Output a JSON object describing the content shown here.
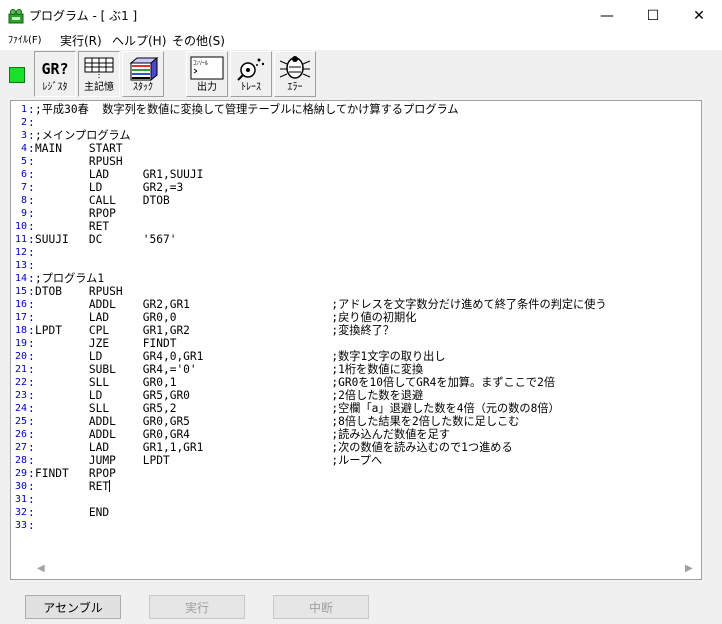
{
  "window": {
    "title": "プログラム - [ ぶ1 ]",
    "minimize": "—",
    "maximize": "☐",
    "close": "✕"
  },
  "menu": [
    {
      "label": "ﾌｧｲﾙ(F)"
    },
    {
      "label": "実行(R)"
    },
    {
      "label": "ヘルプ(H)"
    },
    {
      "label": "その他(S)"
    }
  ],
  "toolbar": {
    "status_color": "#19e028",
    "buttons": [
      {
        "label": "ﾚｼﾞｽﾀ",
        "icon_text": "GR?",
        "icon": "register-icon"
      },
      {
        "label": "主記憶",
        "icon": "memory-grid-icon"
      },
      {
        "label": "ｽﾀｯｸ",
        "icon": "stack-icon"
      },
      {
        "label": "出力",
        "icon_text": "ｺﾝｿｰﾙ",
        "icon": "console-icon"
      },
      {
        "label": "ﾄﾚｰｽ",
        "icon": "trace-icon"
      },
      {
        "label": "ｴﾗｰ",
        "icon": "error-bug-icon"
      }
    ]
  },
  "editor": {
    "lines": [
      ";平成30春  数字列を数値に変換して管理テーブルに格納してかけ算するプログラム",
      "",
      ";メインプログラム",
      "MAIN    START",
      "        RPUSH",
      "        LAD     GR1,SUUJI",
      "        LD      GR2,=3",
      "        CALL    DTOB",
      "        RPOP",
      "        RET",
      "SUUJI   DC      '567'",
      "",
      "",
      ";プログラム1",
      "DTOB    RPUSH",
      "        ADDL    GR2,GR1                     ;アドレスを文字数分だけ進めて終了条件の判定に使う",
      "        LAD     GR0,0                       ;戻り値の初期化",
      "LPDT    CPL     GR1,GR2                     ;変換終了？",
      "        JZE     FINDT",
      "        LD      GR4,0,GR1                   ;数字1文字の取り出し",
      "        SUBL    GR4,='0'                    ;1桁を数値に変換",
      "        SLL     GR0,1                       ;GR0を10倍してGR4を加算。まずここで2倍",
      "        LD      GR5,GR0                     ;2倍した数を退避",
      "        SLL     GR5,2                       ;空欄「a」退避した数を4倍（元の数の8倍）",
      "        ADDL    GR0,GR5                     ;8倍した結果を2倍した数に足しこむ",
      "        ADDL    GR0,GR4                     ;読み込んだ数値を足す",
      "        LAD     GR1,1,GR1                   ;次の数値を読み込むので1つ進める",
      "        JUMP    LPDT                        ;ループへ",
      "FINDT   RPOP",
      "        RET",
      "",
      "        END",
      ""
    ]
  },
  "buttons": {
    "assemble": "アセンブル",
    "run": "実行",
    "stop": "中断"
  }
}
